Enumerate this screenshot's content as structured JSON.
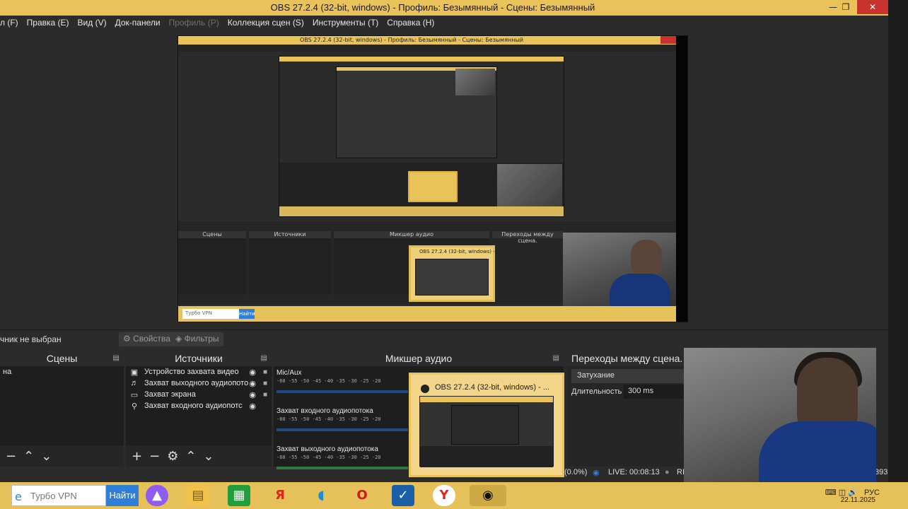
{
  "window": {
    "title": "OBS 27.2.4 (32-bit, windows) - Профиль: Безымянный - Сцены: Безымянный"
  },
  "menu": [
    "Файл (F)",
    "Правка (E)",
    "Вид (V)",
    "Док-панели",
    "Профиль (P)",
    "Коллекция сцен (S)",
    "Инструменты (T)",
    "Справка (H)"
  ],
  "menu_visible": [
    "Правка (E)",
    "Вид (V)",
    "Док-панели",
    "Профиль (P)",
    "Коллекция сцен (S)",
    "Инструменты (T)",
    "Справка (H)"
  ],
  "menu_first": "л (F)",
  "selection": {
    "none_label": "чник не выбран",
    "props_label": "Свойства",
    "filters_label": "Фильтры"
  },
  "docks": {
    "scenes": {
      "title": "Сцены",
      "items": [
        "на"
      ]
    },
    "sources": {
      "title": "Источники",
      "items": [
        {
          "icon": "camera-icon",
          "label": "Устройство захвата видео"
        },
        {
          "icon": "speaker-icon",
          "label": "Захват выходного аудиопото"
        },
        {
          "icon": "monitor-icon",
          "label": "Захват экрана"
        },
        {
          "icon": "microphone-icon",
          "label": "Захват входного аудиопотс"
        }
      ]
    },
    "mixer": {
      "title": "Микшер аудио",
      "channels": [
        {
          "name": "Mic/Aux",
          "meter": "blue"
        },
        {
          "name": "Захват входного аудиопотока",
          "meter": "blue"
        },
        {
          "name": "Захват выходного аудиопотока",
          "meter": "green"
        }
      ],
      "ticks": "-60  -55  -50  -45  -40  -35  -30  -25  -20"
    },
    "transitions": {
      "title": "Переходы между сцена.",
      "type": "Затухание",
      "duration_label": "Длительность",
      "duration_value": "300 ms"
    }
  },
  "popup": {
    "title": "OBS 27.2.4 (32-bit, windows) - ..."
  },
  "status": {
    "cpu": "(0.0%)",
    "live": "LIVE: 00:08:13",
    "rec": "RI",
    "extra": "393"
  },
  "taskbar": {
    "search_placeholder": "Турбо VPN",
    "find_label": "Найти",
    "lang": "РУС",
    "date": "22.11.2025"
  },
  "nested": {
    "title": "OBS 27.2.4 (32-bit, windows) - Профиль: Безымянный - Сцены: Безымянный",
    "scenes": "Сцены",
    "sources": "Источники",
    "mixer": "Микшер аудио",
    "transitions": "Переходы между сцена.",
    "search": "Турбо VPN",
    "find": "Найти"
  },
  "colors": {
    "accent": "#e9c35a",
    "close": "#c8332e",
    "meter_blue": "#1f4a8a",
    "meter_green": "#2d7a3a"
  }
}
